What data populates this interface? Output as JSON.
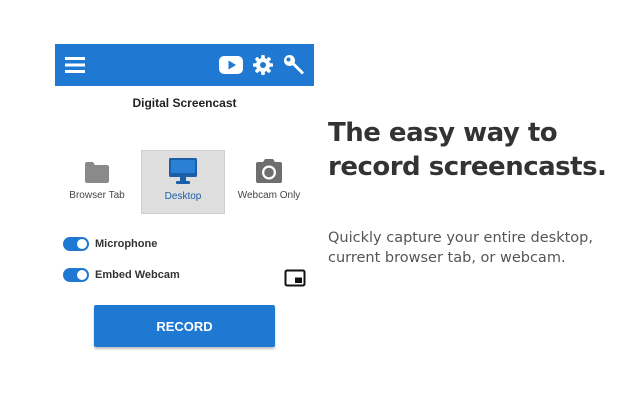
{
  "colors": {
    "accent": "#1f78d1",
    "selected_bg": "#dedede",
    "text": "#333333"
  },
  "topbar": {
    "icons": [
      "menu-icon",
      "youtube-icon",
      "gear-icon",
      "key-icon"
    ]
  },
  "app": {
    "title": "Digital Screencast"
  },
  "modes": [
    {
      "label": "Browser Tab",
      "icon": "folder-icon",
      "selected": false
    },
    {
      "label": "Desktop",
      "icon": "monitor-icon",
      "selected": true
    },
    {
      "label": "Webcam Only",
      "icon": "camera-icon",
      "selected": false
    }
  ],
  "options": {
    "microphone": {
      "label": "Microphone",
      "enabled": true
    },
    "embed_webcam": {
      "label": "Embed Webcam",
      "enabled": true
    }
  },
  "record": {
    "label": "RECORD"
  },
  "marketing": {
    "headline_1": "The easy way to",
    "headline_2": "record screencasts.",
    "sub_1": "Quickly capture your entire desktop,",
    "sub_2": "current browser tab, or webcam."
  }
}
